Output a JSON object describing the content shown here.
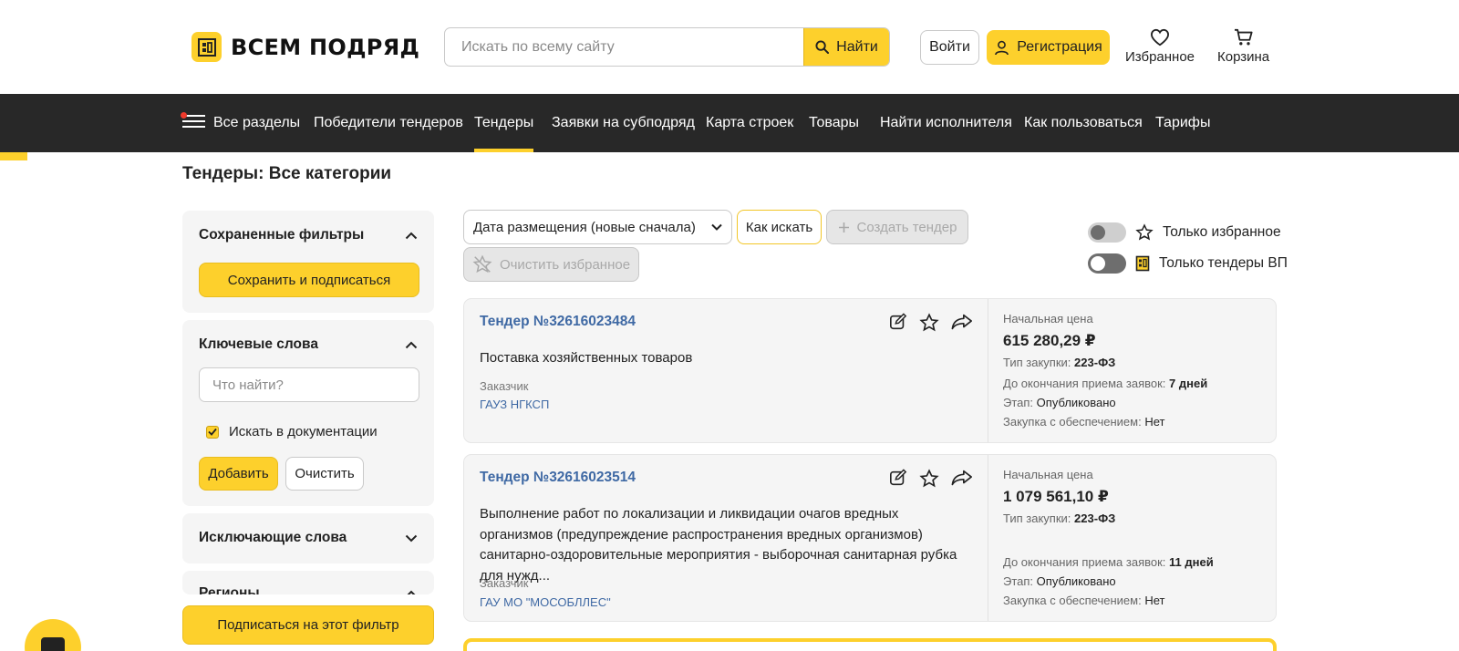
{
  "header": {
    "logo_text": "ВСЕМ ПОДРЯД",
    "search_placeholder": "Искать по всему сайту",
    "search_button": "Найти",
    "login": "Войти",
    "register": "Регистрация",
    "favorites": "Избранное",
    "cart": "Корзина"
  },
  "nav": {
    "items": [
      {
        "label": "Все разделы"
      },
      {
        "label": "Победители тендеров"
      },
      {
        "label": "Тендеры",
        "active": true
      },
      {
        "label": "Заявки на субподряд"
      },
      {
        "label": "Карта строек"
      },
      {
        "label": "Товары"
      },
      {
        "label": "Найти исполнителя"
      },
      {
        "label": "Как пользоваться"
      },
      {
        "label": "Тарифы"
      }
    ]
  },
  "page_title": "Тендеры: Все категории",
  "sidebar": {
    "saved_filters": {
      "title": "Сохраненные фильтры",
      "save_button": "Сохранить и подписаться"
    },
    "keywords": {
      "title": "Ключевые слова",
      "input_placeholder": "Что найти?",
      "search_docs_label": "Искать в документации",
      "add_button": "Добавить",
      "clear_button": "Очистить"
    },
    "exclude_words": {
      "title": "Исключающие слова"
    },
    "regions": {
      "title": "Регионы"
    },
    "subscribe_button": "Подписаться на этот фильтр"
  },
  "toolbar": {
    "sort_value": "Дата размещения (новые сначала)",
    "how_to_search": "Как искать",
    "create_tender": "Создать тендер",
    "clear_favorites": "Очистить избранное",
    "only_favorites": "Только избранное",
    "only_vp": "Только тендеры ВП"
  },
  "tenders": [
    {
      "title": "Тендер №32616023484",
      "description": "Поставка хозяйственных товаров",
      "customer_label": "Заказчик",
      "customer": "ГАУЗ НГКСП",
      "price_label": "Начальная цена",
      "price": "615 280,29 ₽",
      "procurement_type_label": "Тип закупки:",
      "procurement_type": "223-ФЗ",
      "deadline_label": "До окончания приема заявок:",
      "deadline": "7 дней",
      "stage_label": "Этап:",
      "stage": "Опубликовано",
      "security_label": "Закупка с обеспечением:",
      "security": "Нет"
    },
    {
      "title": "Тендер №32616023514",
      "description": "Выполнение работ по локализации и ликвидации очагов вредных организмов (предупреждение распространения вредных организмов) санитарно-оздоровительные мероприятия - выборочная санитарная рубка для нужд...",
      "customer_label": "Заказчик",
      "customer": "ГАУ МО \"МОСОБЛЛЕС\"",
      "price_label": "Начальная цена",
      "price": "1 079 561,10 ₽",
      "procurement_type_label": "Тип закупки:",
      "procurement_type": "223-ФЗ",
      "deadline_label": "До окончания приема заявок:",
      "deadline": "11 дней",
      "stage_label": "Этап:",
      "stage": "Опубликовано",
      "security_label": "Закупка с обеспечением:",
      "security": "Нет"
    }
  ],
  "colors": {
    "accent": "#fdd02c",
    "nav_bg": "#282828",
    "link": "#3f69a4",
    "panel_bg": "#f5f5f5"
  }
}
